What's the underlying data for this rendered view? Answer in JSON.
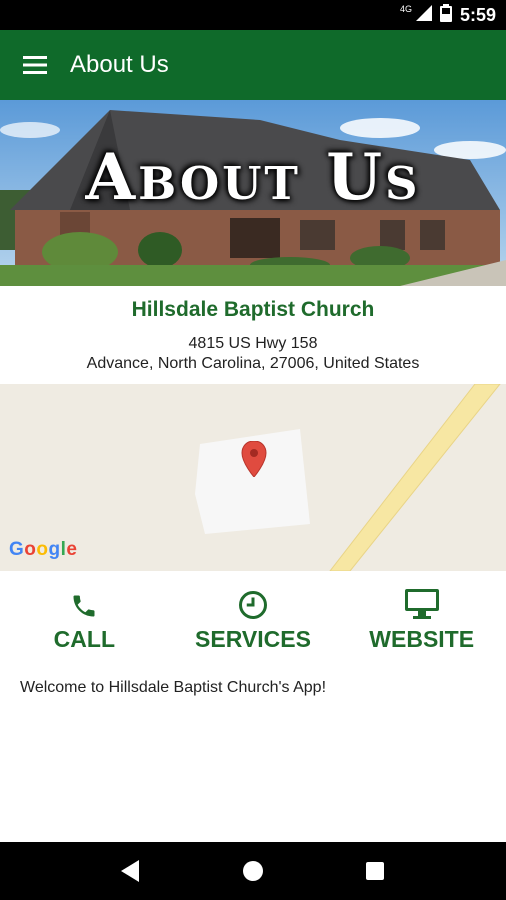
{
  "status_bar": {
    "network": "4G",
    "time": "5:59"
  },
  "app_bar": {
    "title": "About Us",
    "menu_icon": "menu-icon"
  },
  "hero": {
    "title": "About Us"
  },
  "church": {
    "name": "Hillsdale Baptist Church",
    "address_line1": "4815 US Hwy 158",
    "address_line2": "Advance, North Carolina, 27006, United States"
  },
  "map": {
    "logo": "Google"
  },
  "actions": [
    {
      "label": "CALL",
      "icon": "phone-icon"
    },
    {
      "label": "SERVICES",
      "icon": "clock-icon"
    },
    {
      "label": "WEBSITE",
      "icon": "monitor-icon"
    }
  ],
  "welcome_text": "Welcome to Hillsdale Baptist Church's App!",
  "colors": {
    "primary": "#0f6a2a",
    "accent_text": "#1f6b2c",
    "map_bg": "#efebe2",
    "road": "#f7e7a3",
    "pin": "#e04b3f"
  }
}
